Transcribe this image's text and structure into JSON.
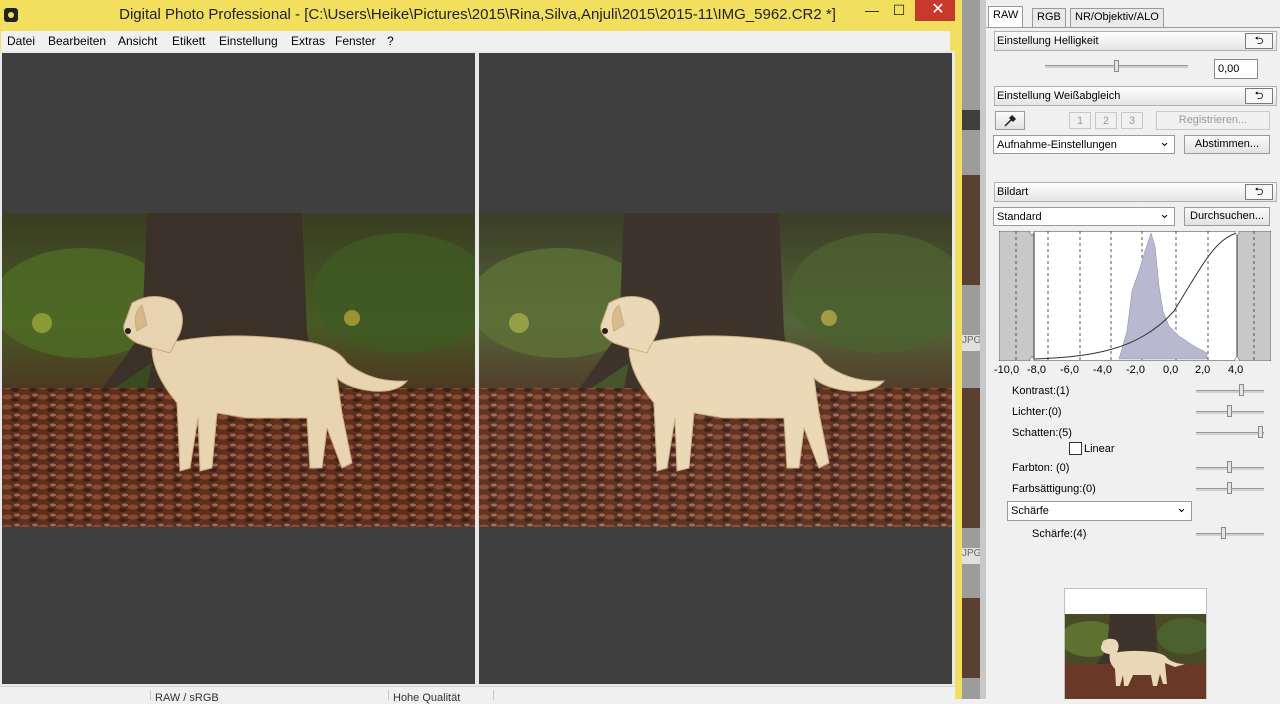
{
  "window": {
    "title": "Digital Photo Professional - [C:\\Users\\Heike\\Pictures\\2015\\Rina,Silva,Anjuli\\2015\\2015-11\\IMG_5962.CR2 *]",
    "minimize_glyph": "—",
    "maximize_glyph": "☐",
    "close_glyph": "✕"
  },
  "menu": {
    "items": [
      "Datei",
      "Bearbeiten",
      "Ansicht",
      "Etikett",
      "Einstellung",
      "Extras",
      "Fenster",
      "?"
    ]
  },
  "statusbar": {
    "left_text": "RAW / sRGB",
    "right_text": "Hohe Qualität"
  },
  "background_windows": {
    "labels": [
      "JPG",
      "JPG"
    ]
  },
  "palette": {
    "tabs": [
      "RAW",
      "RGB",
      "NR/Objektiv/ALO"
    ],
    "active_tab": "RAW",
    "brightness": {
      "header": "Einstellung Helligkeit",
      "value": "0,00",
      "slider_level": 0.5
    },
    "white_balance": {
      "header": "Einstellung Weißabgleich",
      "eyedropper_icon": "eyedropper-icon",
      "presets": [
        "1",
        "2",
        "3"
      ],
      "register_label": "Registrieren...",
      "selected": "Aufnahme-Einstellungen",
      "adjust_label": "Abstimmen..."
    },
    "picture_style": {
      "header": "Bildart",
      "selected": "Standard",
      "browse_label": "Durchsuchen...",
      "histogram_ticks": [
        "-10,0",
        "-8,0",
        "-6,0",
        "-4,0",
        "-2,0",
        "0,0",
        "2,0",
        "4,0"
      ]
    },
    "params": {
      "contrast": {
        "label": "Kontrast:(1)",
        "level": 0.7
      },
      "highlights": {
        "label": "Lichter:(0)",
        "level": 0.5
      },
      "shadows": {
        "label": "Schatten:(5)",
        "level": 1.0
      },
      "linear_label": "Linear",
      "linear_checked": false,
      "hue": {
        "label": "Farbton: (0)",
        "level": 0.5
      },
      "saturation": {
        "label": "Farbsättigung:(0)",
        "level": 0.5
      },
      "sharpness_mode": "Schärfe",
      "sharpness": {
        "label": "Schärfe:(4)",
        "level": 0.4
      }
    },
    "reset_icon": "undo-arrow-icon"
  },
  "colors": {
    "title_bar": "#f3df5e",
    "close_button": "#c7392c",
    "viewer_background": "#3f3f3f",
    "histogram_fill": "#b8b8d0"
  }
}
